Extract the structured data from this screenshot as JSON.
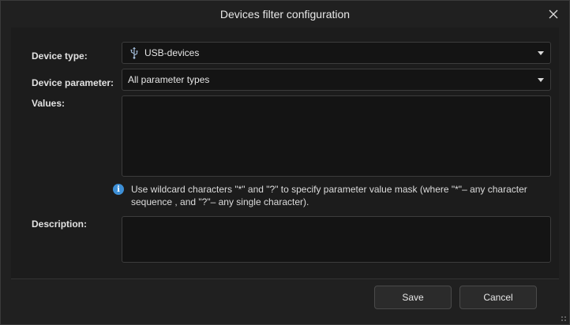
{
  "window": {
    "title": "Devices filter configuration"
  },
  "form": {
    "device_type": {
      "label": "Device type:",
      "value": "USB-devices",
      "icon": "usb-icon"
    },
    "device_parameter": {
      "label": "Device parameter:",
      "value": "All parameter types"
    },
    "values": {
      "label": "Values:",
      "value": ""
    },
    "hint": {
      "icon": "info-icon",
      "text": "Use wildcard characters \"*\" and \"?\" to specify parameter value mask (where \"*\"– any character sequence , and \"?\"– any single character)."
    },
    "description": {
      "label": "Description:",
      "value": ""
    }
  },
  "buttons": {
    "save_label": "Save",
    "cancel_label": "Cancel"
  },
  "colors": {
    "background": "#202020",
    "field": "#141414",
    "info_accent": "#3d8fd6"
  }
}
